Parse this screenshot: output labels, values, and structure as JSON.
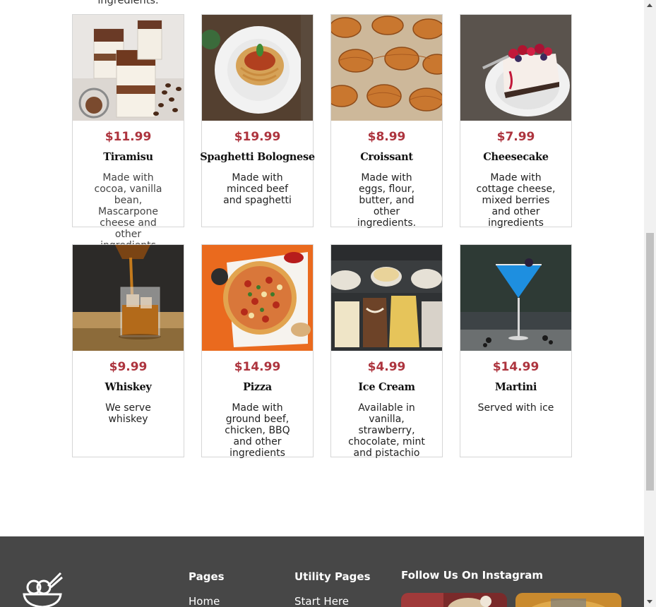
{
  "overflow_text": "ingredients.",
  "menu_items": [
    {
      "price": "$11.99",
      "name": "Tiramisu",
      "description": "Made with cocoa, vanilla bean, Mascarpone cheese and other ingredients"
    },
    {
      "price": "$19.99",
      "name": "Spaghetti Bolognese",
      "description": "Made with minced beef and spaghetti"
    },
    {
      "price": "$8.99",
      "name": "Croissant",
      "description": "Made with eggs, flour, butter, and other ingredients."
    },
    {
      "price": "$7.99",
      "name": "Cheesecake",
      "description": "Made with cottage cheese, mixed berries and other ingredients"
    },
    {
      "price": "$9.99",
      "name": "Whiskey",
      "description": "We serve whiskey"
    },
    {
      "price": "$14.99",
      "name": "Pizza",
      "description": "Made with ground beef, chicken, BBQ and other ingredients"
    },
    {
      "price": "$4.99",
      "name": "Ice Cream",
      "description": "Available in vanilla, strawberry, chocolate, mint and pistachio"
    },
    {
      "price": "$14.99",
      "name": "Martini",
      "description": "Served with ice"
    }
  ],
  "footer": {
    "pages_heading": "Pages",
    "pages_links": [
      "Home"
    ],
    "utility_heading": "Utility Pages",
    "utility_links": [
      "Start Here"
    ],
    "instagram_heading": "Follow Us On Instagram"
  },
  "colors": {
    "price": "#ad343e",
    "footer_bg": "#474747"
  },
  "icons": [
    "ramen-bowl-logo-icon",
    "scroll-up-arrow-icon",
    "scroll-down-arrow-icon"
  ]
}
